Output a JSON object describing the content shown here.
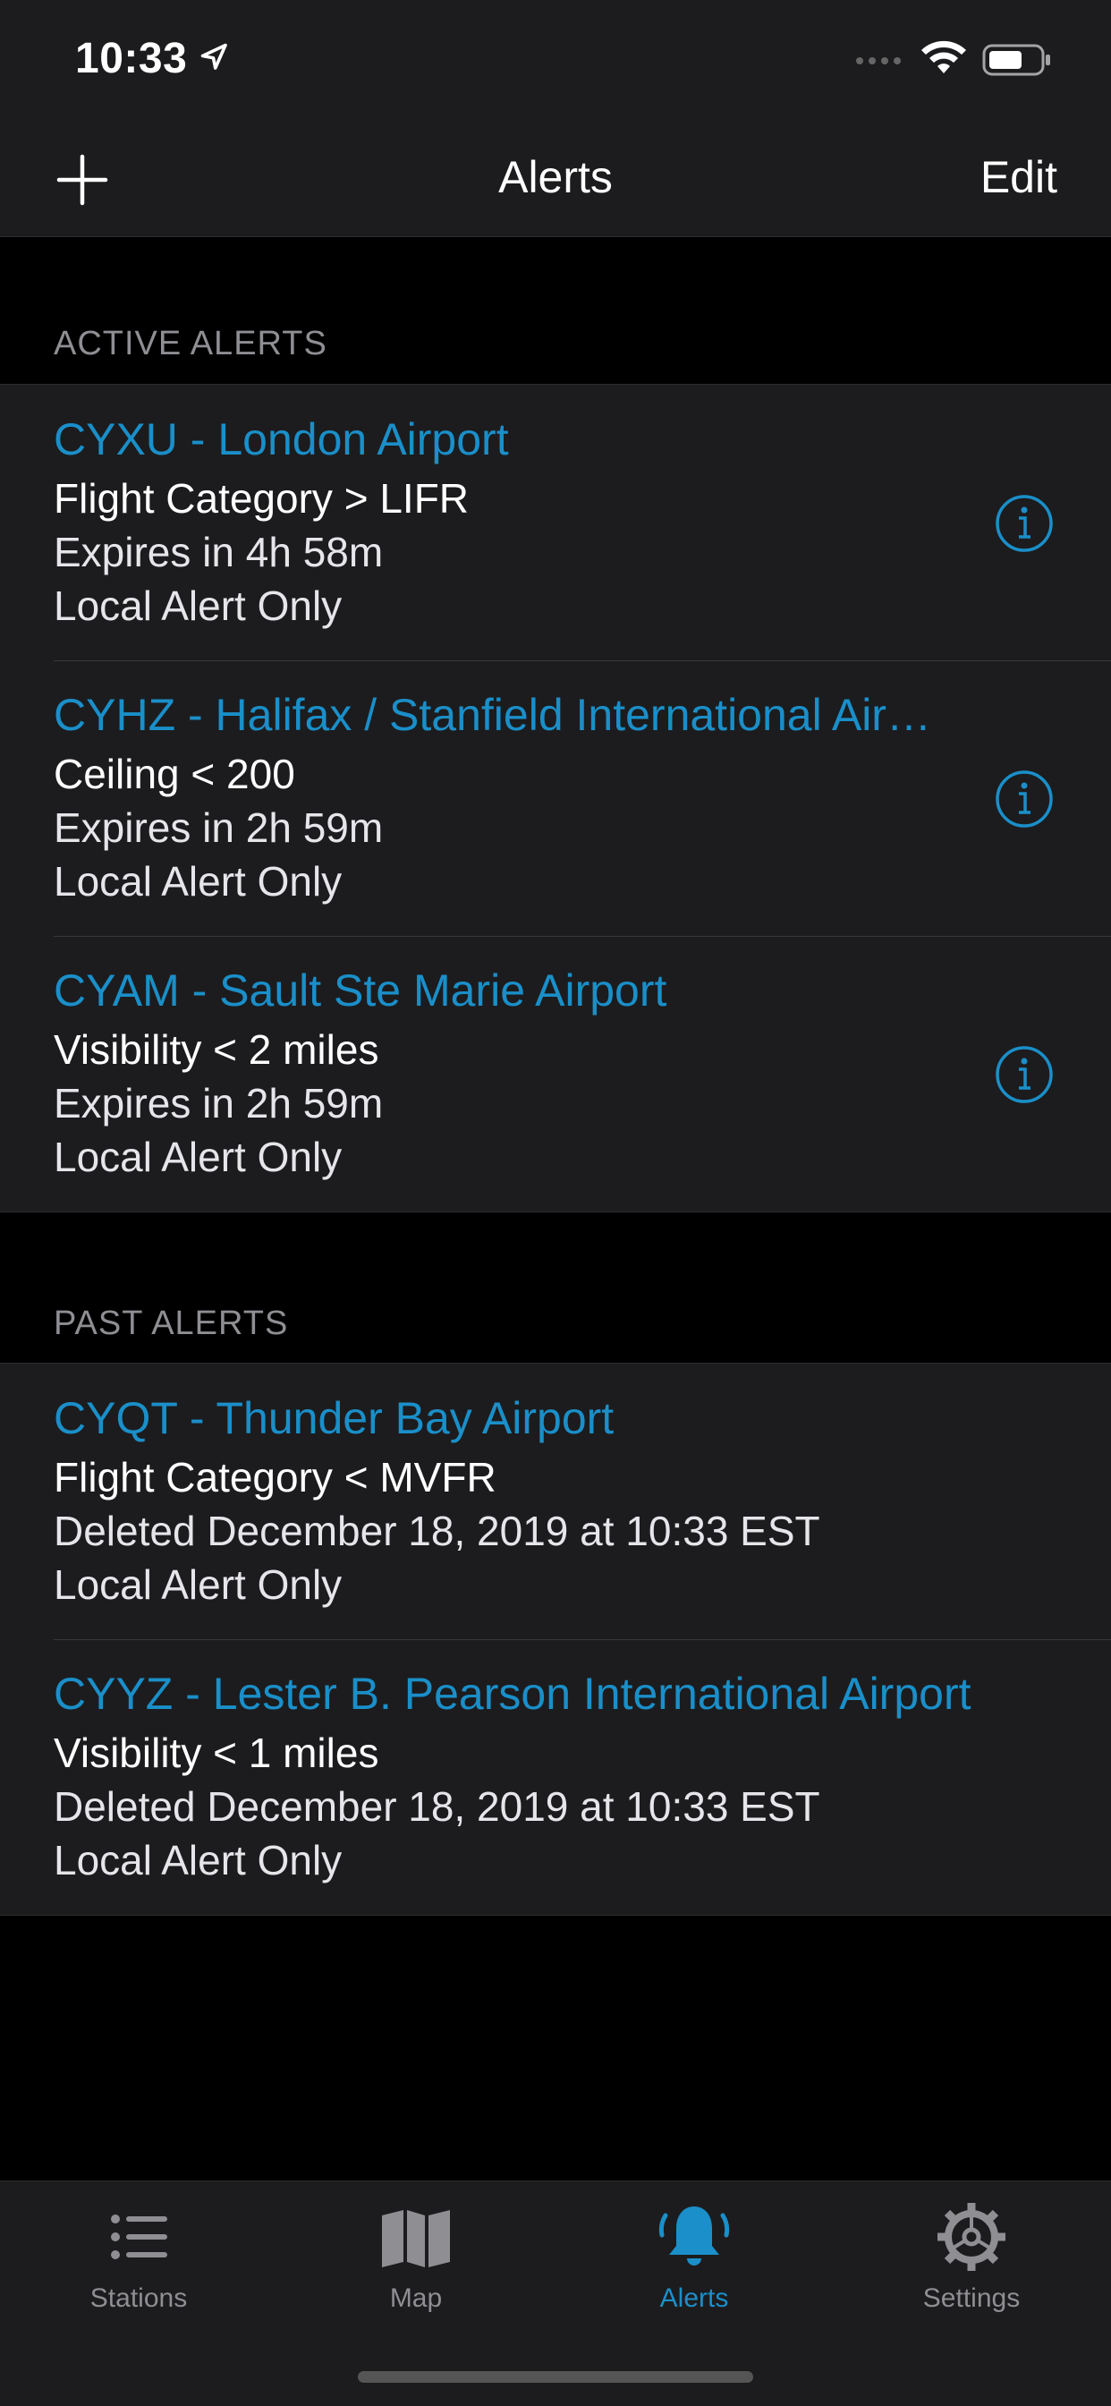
{
  "status_bar": {
    "time": "10:33",
    "icons": [
      "location-arrow-icon",
      "cellular-signal-icon",
      "wifi-icon",
      "battery-icon"
    ]
  },
  "nav": {
    "title": "Alerts",
    "edit_label": "Edit",
    "add_icon": "plus-icon"
  },
  "active_section": {
    "header": "ACTIVE ALERTS",
    "items": [
      {
        "title": "CYXU - London Airport",
        "condition": "Flight Category > LIFR",
        "status": "Expires in 4h 58m",
        "scope": "Local Alert Only"
      },
      {
        "title": "CYHZ - Halifax / Stanfield International Airport",
        "condition": "Ceiling < 200",
        "status": "Expires in 2h 59m",
        "scope": "Local Alert Only"
      },
      {
        "title": "CYAM - Sault Ste Marie Airport",
        "condition": "Visibility < 2 miles",
        "status": "Expires in 2h 59m",
        "scope": "Local Alert Only"
      }
    ]
  },
  "past_section": {
    "header": "PAST ALERTS",
    "items": [
      {
        "title": "CYQT - Thunder Bay Airport",
        "condition": "Flight Category < MVFR",
        "status": "Deleted December 18, 2019 at 10:33 EST",
        "scope": "Local Alert Only"
      },
      {
        "title": "CYYZ - Lester B. Pearson International Airport",
        "condition": "Visibility < 1 miles",
        "status": "Deleted December 18, 2019 at 10:33 EST",
        "scope": "Local Alert Only"
      }
    ]
  },
  "tabs": [
    {
      "label": "Stations",
      "icon": "list-icon",
      "selected": false
    },
    {
      "label": "Map",
      "icon": "map-icon",
      "selected": false
    },
    {
      "label": "Alerts",
      "icon": "bell-icon",
      "selected": true
    },
    {
      "label": "Settings",
      "icon": "gear-icon",
      "selected": false
    }
  ],
  "colors": {
    "accent": "#1a8fc9",
    "background": "#000000",
    "cell_background": "#1c1c1e",
    "secondary_text": "#8e8e93"
  }
}
